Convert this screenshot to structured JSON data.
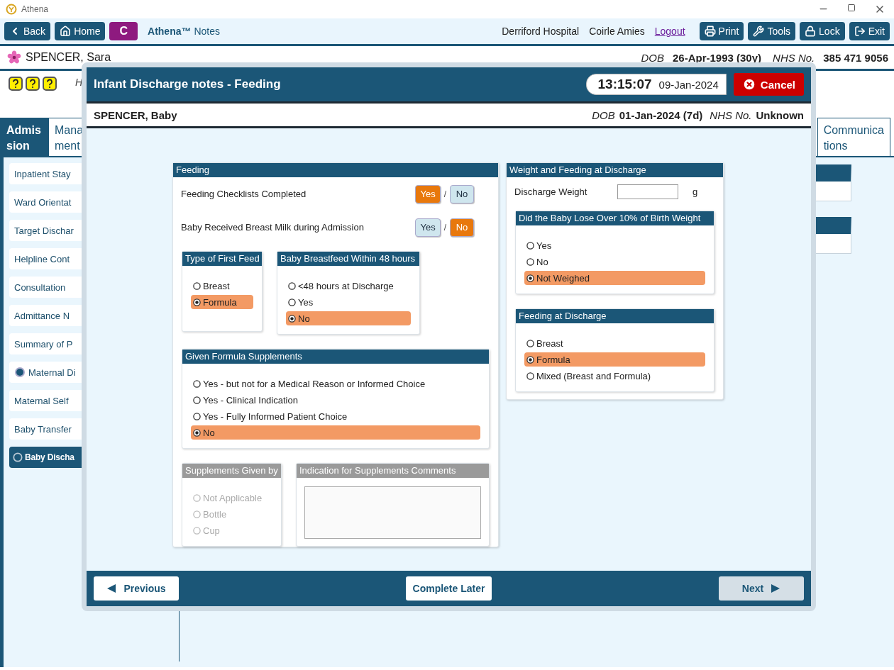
{
  "window": {
    "title": "Athena"
  },
  "toolbar": {
    "left_buttons": [
      {
        "label": "Back",
        "kind": "back"
      },
      {
        "label": "Home",
        "kind": "home"
      },
      {
        "label": "C",
        "kind": "letter"
      }
    ],
    "app_title": "**Athena™** Notes",
    "hospital": "Derriford Hospital",
    "user": "Coirle Amies",
    "logout": "Logout",
    "right_buttons": [
      {
        "label": "Print",
        "kind": "print"
      },
      {
        "label": "Tools",
        "kind": "tools"
      },
      {
        "label": "Lock",
        "kind": "lock"
      },
      {
        "label": "Exit",
        "kind": "exit"
      }
    ]
  },
  "patient": {
    "name": "SPENCER, Sara",
    "dob_label": "DOB",
    "dob": "26-Apr-1993 (30y)",
    "nhs_label": "NHS No.",
    "nhs": "385 471 9056"
  },
  "help_text": "H",
  "tabs": [
    {
      "lines": [
        "Admis",
        "sion"
      ],
      "selected": true
    },
    {
      "lines": [
        "Mana",
        "ment"
      ],
      "selected": false
    },
    {
      "lines": [
        "Communica",
        "tions"
      ],
      "selected": false
    }
  ],
  "sidebar": {
    "items": [
      {
        "label": "Inpatient Stay",
        "kind": "plain",
        "selected": false
      },
      {
        "label": "Ward Orientat",
        "kind": "plain",
        "selected": false
      },
      {
        "label": "Target Dischar",
        "kind": "plain",
        "selected": false
      },
      {
        "label": "Helpline Cont",
        "kind": "plain",
        "selected": false
      },
      {
        "label": "Consultation",
        "kind": "plain",
        "selected": false
      },
      {
        "label": "Admittance N",
        "kind": "plain",
        "selected": false
      },
      {
        "label": "Summary of P",
        "kind": "plain",
        "selected": false
      },
      {
        "label": "Maternal Di",
        "kind": "dot",
        "selected": false
      },
      {
        "label": "Maternal Self",
        "kind": "plain",
        "selected": false
      },
      {
        "label": "Baby Transfer",
        "kind": "plain",
        "selected": false
      },
      {
        "label": "Baby Discha",
        "kind": "ring",
        "selected": true
      }
    ]
  },
  "modal": {
    "title": "Infant Discharge notes - Feeding",
    "time": "13:15:07",
    "date": "09-Jan-2024",
    "cancel": "Cancel",
    "baby": {
      "name": "SPENCER, Baby",
      "dob_label": "DOB",
      "dob": "01-Jan-2024 (7d)",
      "nhs_label": "NHS No.",
      "nhs": "Unknown"
    },
    "feeding": {
      "title": "Feeding",
      "questions": [
        {
          "label": "Feeding Checklists Completed",
          "separator": "/",
          "options": [
            {
              "label": "Yes",
              "selected": true
            },
            {
              "label": "No",
              "selected": false
            }
          ]
        },
        {
          "label": "Baby Received Breast Milk during Admission",
          "separator": "/",
          "options": [
            {
              "label": "Yes",
              "selected": false
            },
            {
              "label": "No",
              "selected": true
            }
          ]
        }
      ],
      "first_feed": {
        "title": "Type of First Feed",
        "disabled": false,
        "options": [
          {
            "label": "Breast",
            "selected": false
          },
          {
            "label": "Formula",
            "selected": true
          }
        ]
      },
      "breastfeed_48": {
        "title": "Baby Breastfeed Within 48 hours",
        "disabled": false,
        "options": [
          {
            "label": "<48 hours at Discharge",
            "selected": false
          },
          {
            "label": "Yes",
            "selected": false
          },
          {
            "label": "No",
            "selected": true
          }
        ]
      },
      "supplements": {
        "title": "Given Formula Supplements",
        "disabled": false,
        "options": [
          {
            "label": "Yes - but not for a Medical Reason or Informed Choice",
            "selected": false
          },
          {
            "label": "Yes - Clinical Indication",
            "selected": false
          },
          {
            "label": "Yes - Fully Informed Patient Choice",
            "selected": false
          },
          {
            "label": "No",
            "selected": true
          }
        ]
      },
      "given_by": {
        "title": "Supplements Given by",
        "disabled": true,
        "options": [
          {
            "label": "Not Applicable",
            "selected": false
          },
          {
            "label": "Bottle",
            "selected": false
          },
          {
            "label": "Cup",
            "selected": false
          }
        ]
      },
      "comments": {
        "title": "Indication for Supplements Comments",
        "disabled": true
      }
    },
    "discharge": {
      "title": "Weight and Feeding at Discharge",
      "weight_label": "Discharge Weight",
      "weight_unit": "g",
      "weight_loss": {
        "title": "Did the Baby Lose Over 10% of Birth Weight",
        "disabled": false,
        "options": [
          {
            "label": "Yes",
            "selected": false
          },
          {
            "label": "No",
            "selected": false
          },
          {
            "label": "Not Weighed",
            "selected": true
          }
        ]
      },
      "feeding": {
        "title": "Feeding at Discharge",
        "disabled": false,
        "options": [
          {
            "label": "Breast",
            "selected": false
          },
          {
            "label": "Formula",
            "selected": true
          },
          {
            "label": "Mixed (Breast and Formula)",
            "selected": false
          }
        ]
      }
    },
    "footer": {
      "previous": {
        "label": "Previous",
        "disabled": false
      },
      "later": {
        "label": "Complete Later",
        "disabled": false
      },
      "next": {
        "label": "Next",
        "disabled": true
      }
    }
  }
}
